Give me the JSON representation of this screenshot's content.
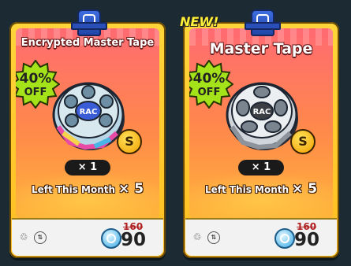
{
  "cards": [
    {
      "title": "Encrypted Master Tape",
      "badge_percent": "40%",
      "badge_off": "OFF",
      "reel_label": "RAC",
      "coin_symbol": "S",
      "quantity": "× 1",
      "left_label": "Left This Month",
      "left_count": "× 5",
      "old_price": "160",
      "price": "90",
      "icons": [
        "recycle-icon",
        "trade-icon",
        "gem-currency-icon"
      ],
      "colors": {
        "accent": "#ffd53a",
        "header": "#ff6a72"
      }
    },
    {
      "tag": "NEW!",
      "title": "Master Tape",
      "badge_percent": "40%",
      "badge_off": "OFF",
      "reel_label": "RAC",
      "coin_symbol": "S",
      "quantity": "× 1",
      "left_label": "Left This Month",
      "left_count": "× 5",
      "old_price": "160",
      "price": "90",
      "icons": [
        "recycle-icon",
        "trade-icon",
        "gem-currency-icon"
      ],
      "colors": {
        "accent": "#ffd53a",
        "header": "#ff6a72"
      }
    }
  ]
}
